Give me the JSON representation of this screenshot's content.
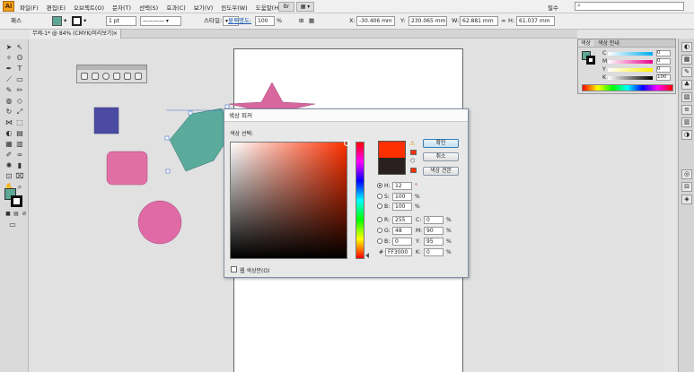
{
  "app": {
    "logo": "Ai"
  },
  "menu": [
    "파일(F)",
    "편집(E)",
    "오브젝트(O)",
    "문자(T)",
    "선택(S)",
    "효과(C)",
    "보기(V)",
    "윈도우(W)",
    "도움말(H)"
  ],
  "workspace": "필수",
  "search": {
    "icon": "search-icon"
  },
  "control": {
    "selection_label": "패스",
    "stroke_width": "1 pt",
    "opacity_label": "스타일:",
    "opacity_link": "불투명도:",
    "opacity_value": "100",
    "opacity_unit": "%",
    "x_label": "X:",
    "x_value": "-30.406 mm",
    "y_label": "Y:",
    "y_value": "230.065 mm",
    "w_label": "W:",
    "w_value": "62.881 mm",
    "h_label": "H:",
    "h_value": "61.037 mm"
  },
  "document": {
    "tab": "무제-1* @ 84% (CMYK/미리보기)",
    "close": "×"
  },
  "color_panel": {
    "tabs": [
      "색상",
      "색상 안내"
    ],
    "rows": [
      {
        "label": "C",
        "value": "0"
      },
      {
        "label": "M",
        "value": "0"
      },
      {
        "label": "Y",
        "value": "0"
      },
      {
        "label": "K",
        "value": "100"
      }
    ],
    "fill": "#5ea896"
  },
  "dialog": {
    "title": "색상 피커",
    "select_label": "색상 선택:",
    "ok": "확인",
    "cancel": "취소",
    "swatches": "색상 견본",
    "hsb": [
      {
        "label": "H:",
        "value": "12",
        "unit": "°"
      },
      {
        "label": "S:",
        "value": "100",
        "unit": "%"
      },
      {
        "label": "B:",
        "value": "100",
        "unit": "%"
      }
    ],
    "rgb": [
      {
        "label": "R:",
        "value": "255"
      },
      {
        "label": "G:",
        "value": "48"
      },
      {
        "label": "B:",
        "value": "0"
      }
    ],
    "cmyk": [
      {
        "label": "C:",
        "value": "0",
        "unit": "%"
      },
      {
        "label": "M:",
        "value": "90",
        "unit": "%"
      },
      {
        "label": "Y:",
        "value": "95",
        "unit": "%"
      },
      {
        "label": "K:",
        "value": "0",
        "unit": "%"
      }
    ],
    "hex_label": "#",
    "hex": "FF3000",
    "web_only": "웹 색상만(O)",
    "new_color": "#ff3000",
    "old_color": "#2a2020"
  },
  "colors": {
    "square": "#4b4ba3",
    "rounded": "#e06fa3",
    "circle": "#e06aa6",
    "hexagon": "#5aab9c",
    "star": "#d8679e"
  }
}
